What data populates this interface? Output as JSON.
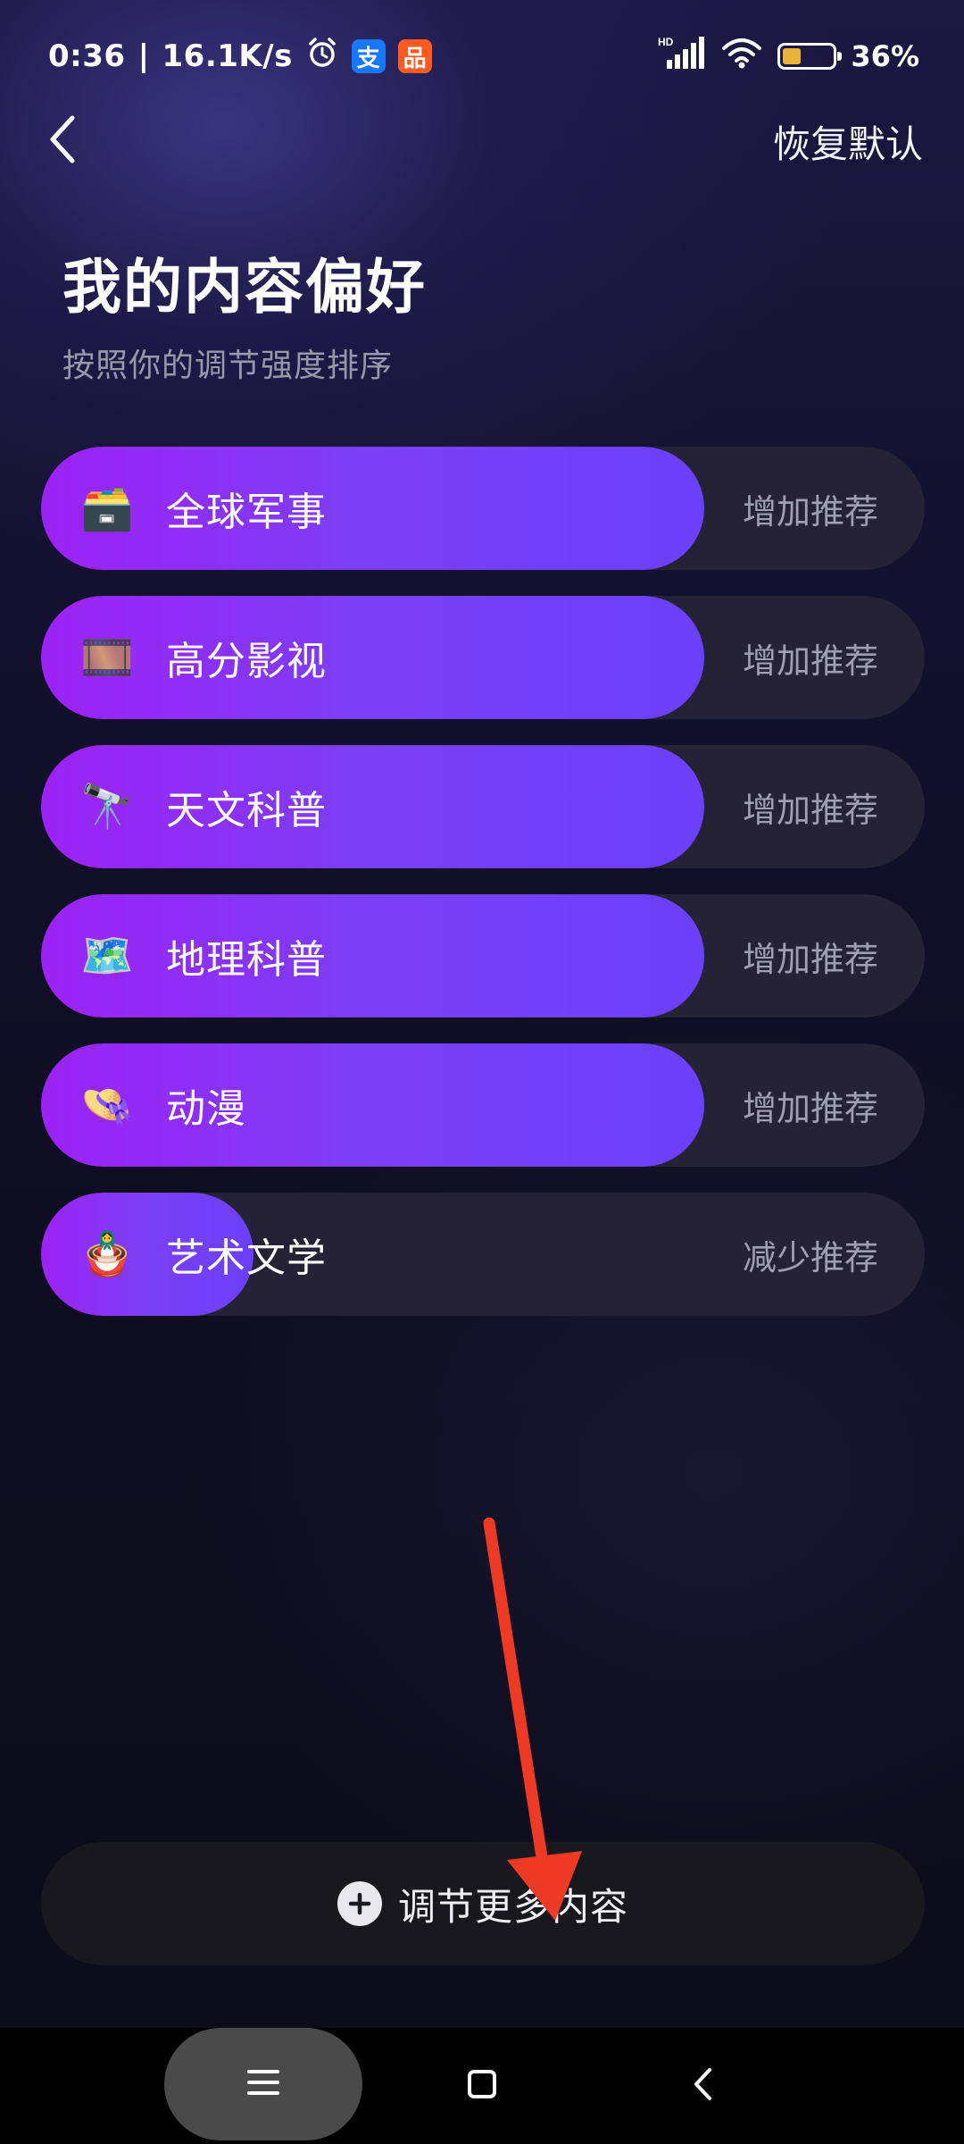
{
  "status_bar": {
    "time": "0:36",
    "network_speed": "16.1K/s",
    "alarm_icon": "alarm-clock-icon",
    "app_icons": [
      {
        "name": "alipay-icon",
        "glyph": "支",
        "color": "#1677ff"
      },
      {
        "name": "taobao-icon",
        "glyph": "品",
        "color": "#ff5a1f"
      }
    ],
    "signal_label": "HD",
    "battery_percent": "36%",
    "battery_level": 0.36,
    "battery_color": "#e8b33a"
  },
  "header": {
    "back_icon": "back-chevron-icon",
    "reset_label": "恢复默认",
    "title": "我的内容偏好",
    "subtitle": "按照你的调节强度排序"
  },
  "preferences": [
    {
      "label": "全球军事",
      "icon": "🗃️",
      "icon_name": "card-file-box-icon",
      "action": "增加推荐",
      "level": 0.75
    },
    {
      "label": "高分影视",
      "icon": "🎞️",
      "icon_name": "film-frames-icon",
      "action": "增加推荐",
      "level": 0.75
    },
    {
      "label": "天文科普",
      "icon": "🔭",
      "icon_name": "telescope-icon",
      "action": "增加推荐",
      "level": 0.75
    },
    {
      "label": "地理科普",
      "icon": "🗺️",
      "icon_name": "world-map-icon",
      "action": "增加推荐",
      "level": 0.75
    },
    {
      "label": "动漫",
      "icon": "👒",
      "icon_name": "straw-hat-icon",
      "action": "增加推荐",
      "level": 0.75
    },
    {
      "label": "艺术文学",
      "icon": "🪆",
      "icon_name": "nesting-doll-icon",
      "action": "减少推荐",
      "level": 0.24
    }
  ],
  "bottom": {
    "more_label": "调节更多内容",
    "plus_icon": "plus-circle-icon"
  },
  "annotation": {
    "arrow_color": "#ee3a24"
  },
  "nav_bar": {
    "menu_icon": "menu-icon",
    "home_icon": "home-square-icon",
    "back_icon": "nav-back-icon"
  }
}
